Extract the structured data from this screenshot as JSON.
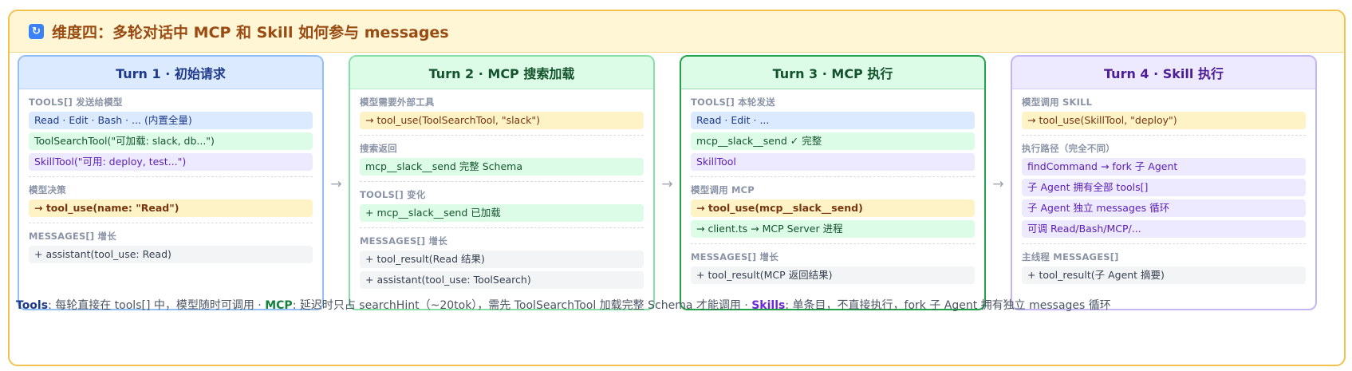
{
  "header": {
    "icon": "refresh-icon",
    "title": "维度四：多轮对话中 MCP 和 Skill 如何参与 messages"
  },
  "arrow_glyph": "→",
  "turn1": {
    "title": "Turn 1 · 初始请求",
    "s1_label": "TOOLS[] 发送给模型",
    "s1_rows": [
      "Read · Edit · Bash · ... (内置全量)",
      "ToolSearchTool(\"可加载: slack, db...\")",
      "SkillTool(\"可用: deploy, test...\")"
    ],
    "s2_label": "模型决策",
    "s2_rows": [
      "→ tool_use(name: \"Read\")"
    ],
    "s3_label": "MESSAGES[] 增长",
    "s3_rows": [
      "+ assistant(tool_use: Read)"
    ]
  },
  "turn2": {
    "title": "Turn 2 · MCP 搜索加载",
    "s1_label": "模型需要外部工具",
    "s1_rows": [
      "→ tool_use(ToolSearchTool, \"slack\")"
    ],
    "s2_label": "搜索返回",
    "s2_rows": [
      "mcp__slack__send 完整 Schema"
    ],
    "s3_label": "TOOLS[] 变化",
    "s3_rows": [
      "+ mcp__slack__send 已加载"
    ],
    "s4_label": "MESSAGES[] 增长",
    "s4_rows": [
      "+ tool_result(Read 结果)",
      "+ assistant(tool_use: ToolSearch)"
    ]
  },
  "turn3": {
    "title": "Turn 3 · MCP 执行",
    "s1_label": "TOOLS[] 本轮发送",
    "s1_rows": [
      "Read · Edit · ...",
      "mcp__slack__send ✓ 完整",
      "SkillTool"
    ],
    "s2_label": "模型调用 MCP",
    "s2_rows": [
      "→ tool_use(mcp__slack__send)",
      "→ client.ts → MCP Server 进程"
    ],
    "s3_label": "MESSAGES[] 增长",
    "s3_rows": [
      "+ tool_result(MCP 返回结果)"
    ]
  },
  "turn4": {
    "title": "Turn 4 · Skill 执行",
    "s1_label": "模型调用 SKILL",
    "s1_rows": [
      "→ tool_use(SkillTool, \"deploy\")"
    ],
    "s2_label": "执行路径（完全不同）",
    "s2_rows": [
      "findCommand → fork 子 Agent",
      "子 Agent 拥有全部 tools[]",
      "子 Agent 独立 messages 循环",
      "可调 Read/Bash/MCP/..."
    ],
    "s3_label": "主线程 MESSAGES[]",
    "s3_rows": [
      "+ tool_result(子 Agent 摘要)"
    ]
  },
  "footer": {
    "tools_term": "Tools",
    "tools_text": ": 每轮直接在 tools[] 中，模型随时可调用 · ",
    "mcp_term": "MCP",
    "mcp_text": ": 延迟时只占 searchHint（~20tok），需先 ToolSearchTool 加载完整 Schema 才能调用 · ",
    "skills_term": "Skills",
    "skills_text": ": 单条目，不直接执行，fork 子 Agent 拥有独立 messages 循环"
  },
  "colors": {
    "frame_border": "#f2c14e",
    "header_bg": "#fff6d6",
    "title_color": "#9a4b12",
    "blue": "#dbeafe",
    "green": "#dcfce7",
    "purple": "#ede9fe",
    "yellow": "#fef3c7",
    "gray": "#f3f4f6"
  }
}
